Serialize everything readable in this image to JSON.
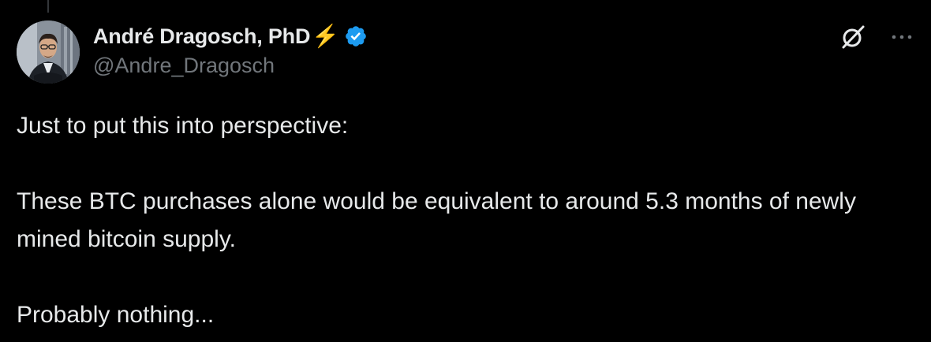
{
  "author": {
    "display_name": "André Dragosch, PhD",
    "emoji": "⚡",
    "handle": "@Andre_Dragosch",
    "verified_color": "#1d9bf0"
  },
  "icons": {
    "grok": "grok-icon",
    "more": "more-icon",
    "verified": "verified-badge-icon"
  },
  "tweet": {
    "paragraphs": [
      "Just to put this into perspective:",
      "These BTC purchases alone would be equivalent to around 5.3 months of newly mined bitcoin supply.",
      "Probably nothing..."
    ]
  },
  "colors": {
    "background": "#000000",
    "text": "#e7e9ea",
    "secondary": "#71767b",
    "accent": "#1d9bf0"
  }
}
